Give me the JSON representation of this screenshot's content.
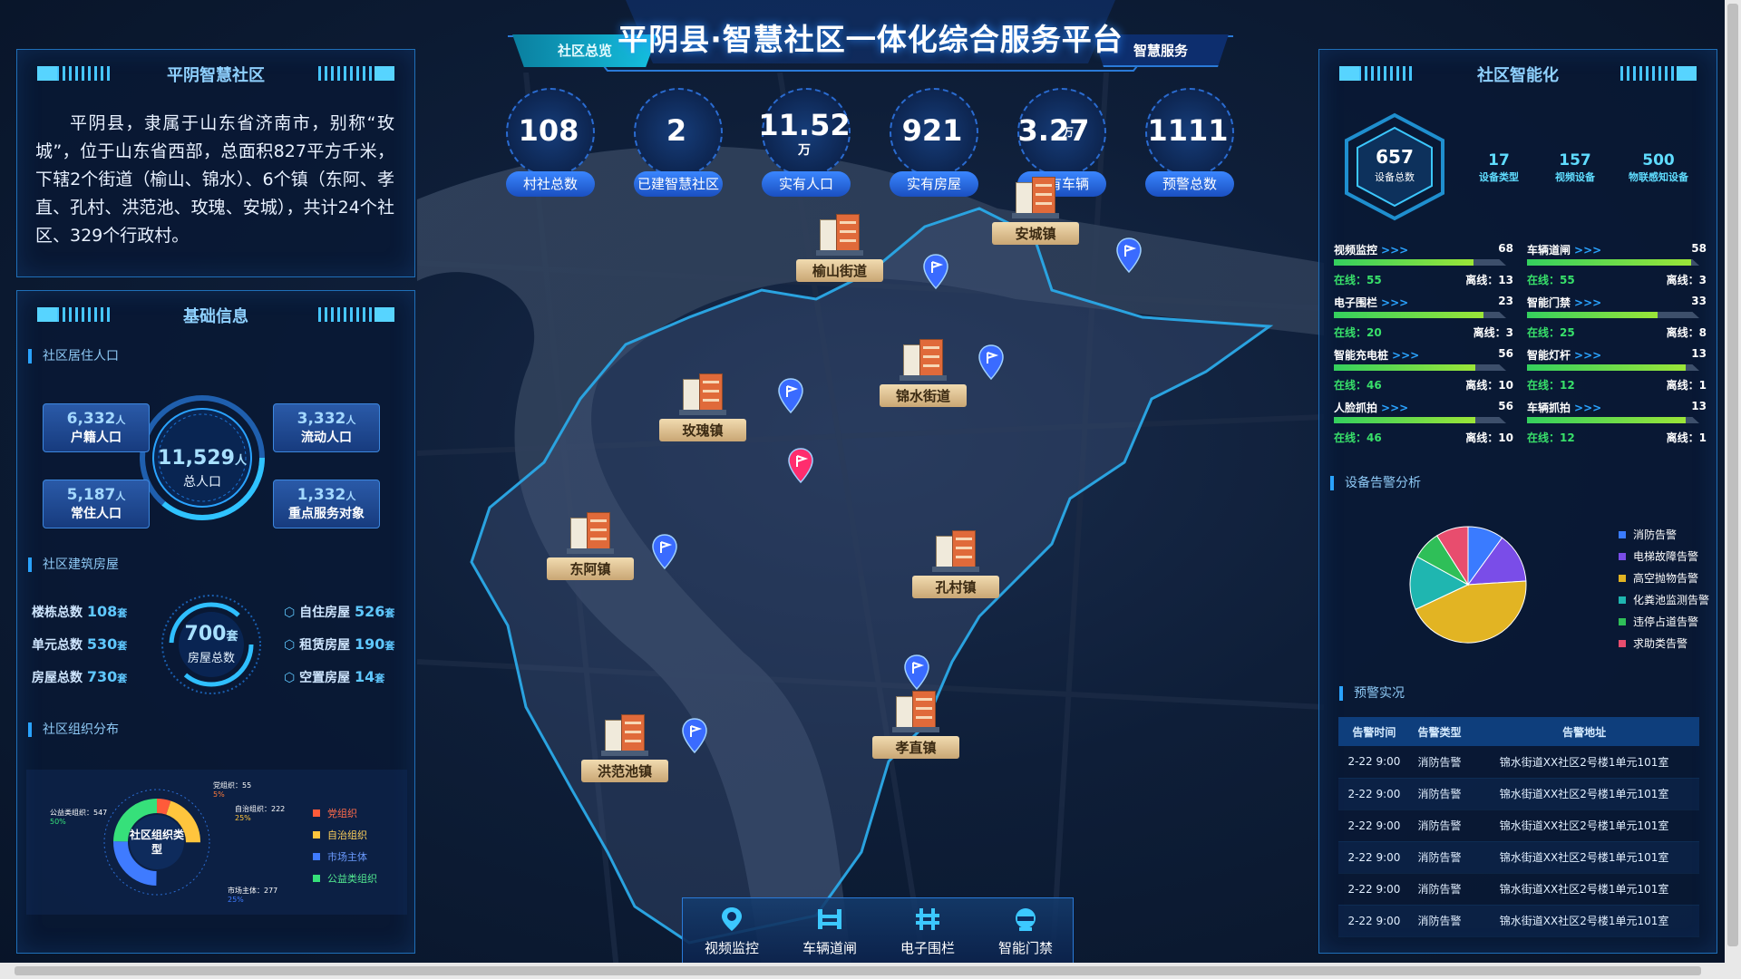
{
  "header": {
    "title": "平阴县·智慧社区一体化综合服务平台",
    "tab_left": "社区总览",
    "tab_right": "智慧服务"
  },
  "stats": [
    {
      "value": "108",
      "unit": "",
      "label": "村社总数"
    },
    {
      "value": "2",
      "unit": "",
      "label": "已建智慧社区"
    },
    {
      "value": "11.52",
      "unit": "万",
      "label": "实有人口"
    },
    {
      "value": "921",
      "unit": "",
      "label": "实有房屋"
    },
    {
      "value": "3.27",
      "unit": "万",
      "label": "实有车辆"
    },
    {
      "value": "1111",
      "unit": "",
      "label": "预警总数"
    }
  ],
  "intro": {
    "title": "平阴智慧社区",
    "text": "平阴县，隶属于山东省济南市，别称“玫城”，位于山东省西部，总面积827平方千米，下辖2个街道（榆山、锦水）、6个镇（东阿、孝直、孔村、洪范池、玫瑰、安城），共计24个社区、329个行政村。"
  },
  "basic": {
    "title": "基础信息",
    "population": {
      "section": "社区居住人口",
      "total": "11,529",
      "total_unit": "人",
      "total_label": "总人口",
      "items": [
        {
          "value": "6,332",
          "unit": "人",
          "label": "户籍人口"
        },
        {
          "value": "3,332",
          "unit": "人",
          "label": "流动人口"
        },
        {
          "value": "5,187",
          "unit": "人",
          "label": "常住人口"
        },
        {
          "value": "1,332",
          "unit": "人",
          "label": "重点服务对象"
        }
      ]
    },
    "housing": {
      "section": "社区建筑房屋",
      "total": "700",
      "total_unit": "套",
      "total_label": "房屋总数",
      "left": [
        {
          "label": "楼栋总数",
          "value": "108",
          "unit": "套"
        },
        {
          "label": "单元总数",
          "value": "530",
          "unit": "套"
        },
        {
          "label": "房屋总数",
          "value": "730",
          "unit": "套"
        }
      ],
      "right": [
        {
          "label": "自住房屋",
          "value": "526",
          "unit": "套"
        },
        {
          "label": "租赁房屋",
          "value": "190",
          "unit": "套"
        },
        {
          "label": "空置房屋",
          "value": "14",
          "unit": "套"
        }
      ]
    },
    "org": {
      "section": "社区组织分布",
      "center": "社区组织类型",
      "callouts": [
        {
          "text": "党组织：55",
          "pct": "5%"
        },
        {
          "text": "自治组织：222",
          "pct": "25%"
        },
        {
          "text": "公益类组织：547",
          "pct": "50%"
        },
        {
          "text": "市场主体：277",
          "pct": "25%"
        }
      ],
      "legend": [
        {
          "label": "党组织",
          "color": "#ff5b3a"
        },
        {
          "label": "自治组织",
          "color": "#ffc53d"
        },
        {
          "label": "市场主体",
          "color": "#3f7bff"
        },
        {
          "label": "公益类组织",
          "color": "#36e07a"
        }
      ]
    }
  },
  "map": {
    "towns": [
      "安城镇",
      "榆山街道",
      "锦水街道",
      "玫瑰镇",
      "东阿镇",
      "孔村镇",
      "孝直镇",
      "洪范池镇"
    ]
  },
  "nav": [
    {
      "label": "视频监控",
      "icon": "location-camera-icon"
    },
    {
      "label": "车辆道闸",
      "icon": "barrier-gate-icon"
    },
    {
      "label": "电子围栏",
      "icon": "fence-icon"
    },
    {
      "label": "智能门禁",
      "icon": "access-control-icon"
    }
  ],
  "smart": {
    "title": "社区智能化",
    "total": {
      "value": "657",
      "label": "设备总数"
    },
    "summary": [
      {
        "value": "17",
        "label": "设备类型"
      },
      {
        "value": "157",
        "label": "视频设备"
      },
      {
        "value": "500",
        "label": "物联感知设备"
      }
    ],
    "devices": [
      {
        "name": "视频监控",
        "count": "68",
        "online": "在线：55",
        "offline": "离线：13",
        "rate": 0.81
      },
      {
        "name": "车辆道闸",
        "count": "58",
        "online": "在线：55",
        "offline": "离线：3",
        "rate": 0.95
      },
      {
        "name": "电子围栏",
        "count": "23",
        "online": "在线：20",
        "offline": "离线：3",
        "rate": 0.87
      },
      {
        "name": "智能门禁",
        "count": "33",
        "online": "在线：25",
        "offline": "离线：8",
        "rate": 0.76
      },
      {
        "name": "智能充电桩",
        "count": "56",
        "online": "在线：46",
        "offline": "离线：10",
        "rate": 0.82
      },
      {
        "name": "智能灯杆",
        "count": "13",
        "online": "在线：12",
        "offline": "离线：1",
        "rate": 0.92
      },
      {
        "name": "人脸抓拍",
        "count": "56",
        "online": "在线：46",
        "offline": "离线：10",
        "rate": 0.82
      },
      {
        "name": "车辆抓拍",
        "count": "13",
        "online": "在线：12",
        "offline": "离线：1",
        "rate": 0.92
      }
    ],
    "arrows": ">>>"
  },
  "alarm_analysis": {
    "section": "设备告警分析"
  },
  "chart_data": {
    "type": "pie",
    "title": "设备告警分析",
    "slices": [
      {
        "label": "消防告警",
        "value": 10,
        "color": "#3a7bff"
      },
      {
        "label": "电梯故障告警",
        "value": 14,
        "color": "#7a4de8"
      },
      {
        "label": "高空抛物告警",
        "value": 44,
        "color": "#e2b423"
      },
      {
        "label": "化粪池监测告警",
        "value": 15,
        "color": "#1fb6b0"
      },
      {
        "label": "违停占道告警",
        "value": 8,
        "color": "#2fbf58"
      },
      {
        "label": "求助类告警",
        "value": 9,
        "color": "#e84d6e"
      }
    ],
    "legend_position": "right"
  },
  "warnings": {
    "section": "预警实况",
    "headers": [
      "告警时间",
      "告警类型",
      "告警地址"
    ],
    "rows": [
      [
        "2-22  9:00",
        "消防告警",
        "锦水街道XX社区2号楼1单元101室"
      ],
      [
        "2-22  9:00",
        "消防告警",
        "锦水街道XX社区2号楼1单元101室"
      ],
      [
        "2-22  9:00",
        "消防告警",
        "锦水街道XX社区2号楼1单元101室"
      ],
      [
        "2-22  9:00",
        "消防告警",
        "锦水街道XX社区2号楼1单元101室"
      ],
      [
        "2-22  9:00",
        "消防告警",
        "锦水街道XX社区2号楼1单元101室"
      ],
      [
        "2-22  9:00",
        "消防告警",
        "锦水街道XX社区2号楼1单元101室"
      ]
    ]
  }
}
